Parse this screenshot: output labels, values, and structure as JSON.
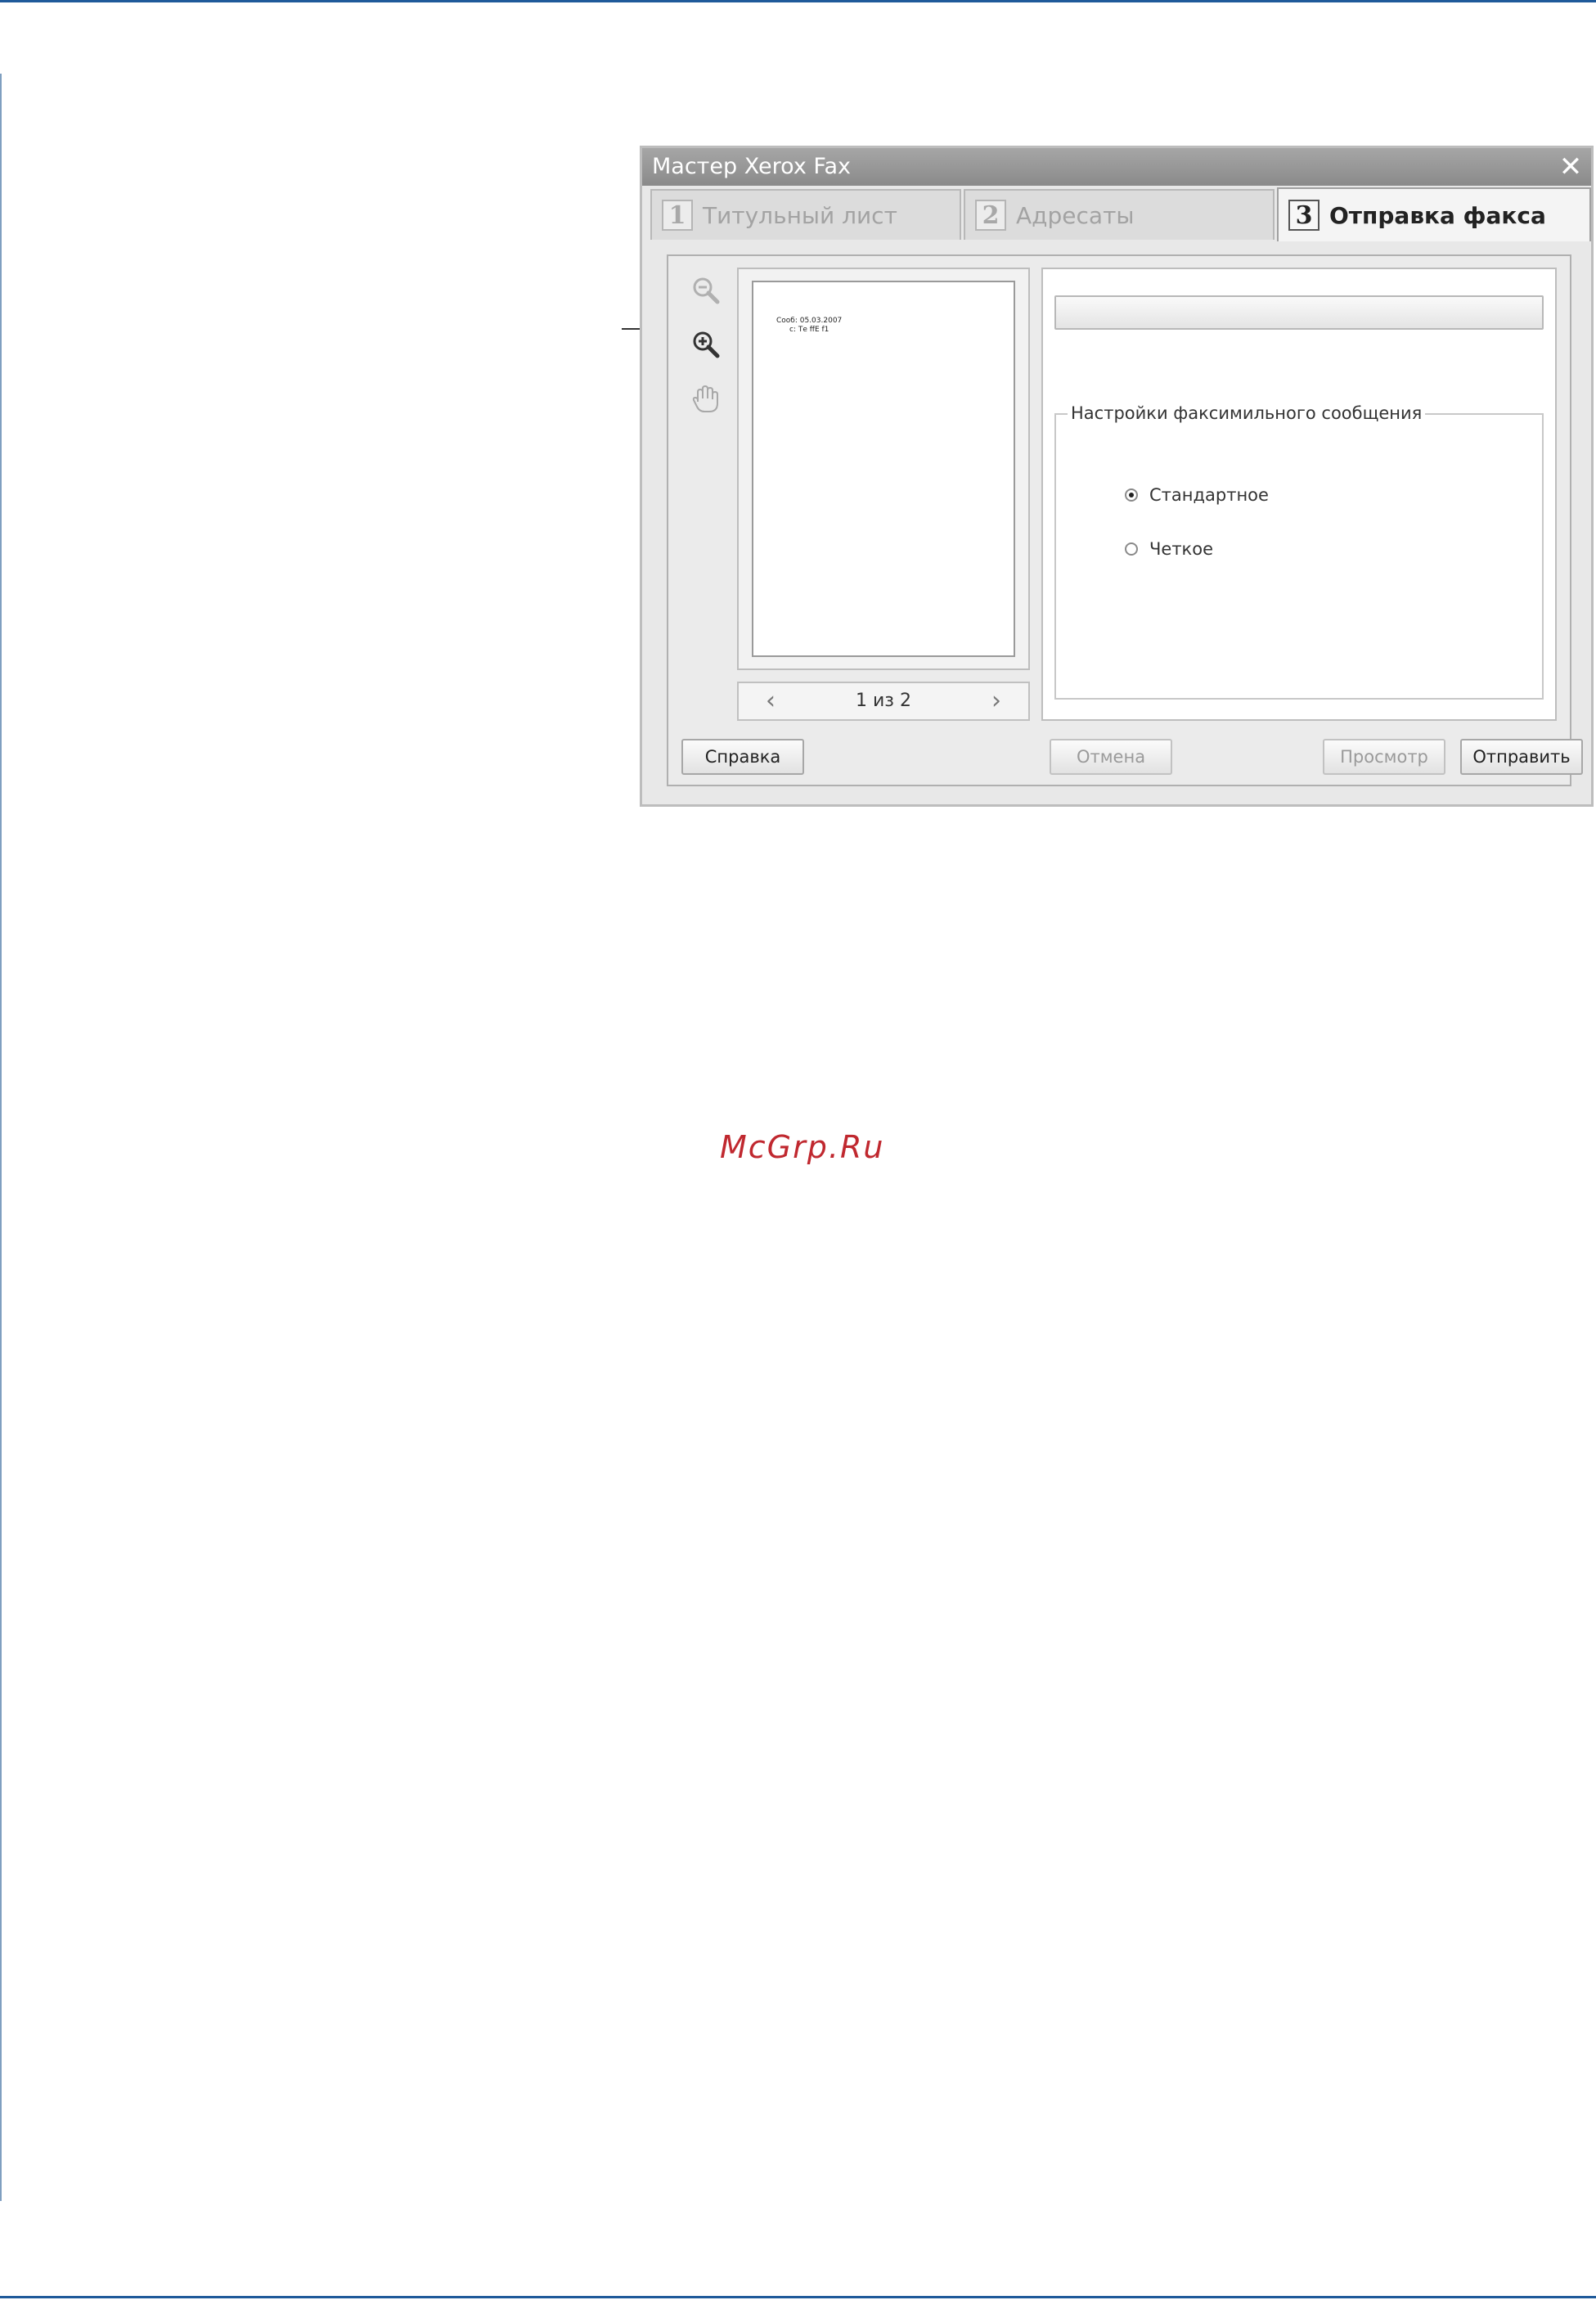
{
  "window": {
    "title": "Мастер Xerox Fax",
    "close_glyph": "✕"
  },
  "tabs": [
    {
      "number": "1",
      "label": "Титульный лист",
      "active": false
    },
    {
      "number": "2",
      "label": "Адресаты",
      "active": false
    },
    {
      "number": "3",
      "label": "Отправка факса",
      "active": true
    }
  ],
  "toolbar": {
    "icons": [
      "zoom-out-icon",
      "zoom-in-icon",
      "hand-pan-icon"
    ]
  },
  "preview": {
    "page_lines": [
      "Сooб: 05.03.2007",
      "с: Те ffЕ f1"
    ],
    "pager": {
      "label": "1 из 2",
      "prev_glyph": "‹",
      "next_glyph": "›"
    }
  },
  "settings": {
    "group_label": "Настройки факсимильного сообщения",
    "options": [
      {
        "label": "Стандартное",
        "selected": true
      },
      {
        "label": "Четкое",
        "selected": false
      }
    ]
  },
  "buttons": {
    "help": "Справка",
    "cancel": "Отмена",
    "preview": "Просмотр",
    "send": "Отправить"
  },
  "watermark": "McGrp.Ru",
  "colors": {
    "rule": "#1f5a9a",
    "titlebar": "#999999",
    "watermark": "#c0282f"
  }
}
